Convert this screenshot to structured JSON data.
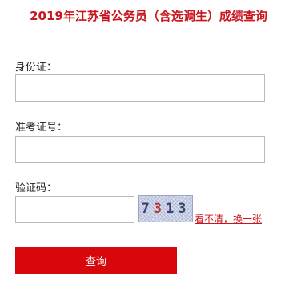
{
  "page": {
    "title": "2019年江苏省公务员（含选调生）成绩查询"
  },
  "form": {
    "id_label": "身份证：",
    "id_value": "",
    "id_placeholder": "",
    "exam_no_label": "准考证号：",
    "exam_no_value": "",
    "exam_no_placeholder": "",
    "captcha_label": "验证码：",
    "captcha_value": "",
    "captcha_placeholder": "",
    "captcha_digits": [
      "7",
      "3",
      "1",
      "3"
    ],
    "refresh_link": "看不清，换一张",
    "submit_label": "查询"
  },
  "colors": {
    "brand_red": "#c9151e",
    "button_red": "#d8070b",
    "input_border": "#b9b9b9",
    "captcha_bg": "#cdd6ea"
  }
}
